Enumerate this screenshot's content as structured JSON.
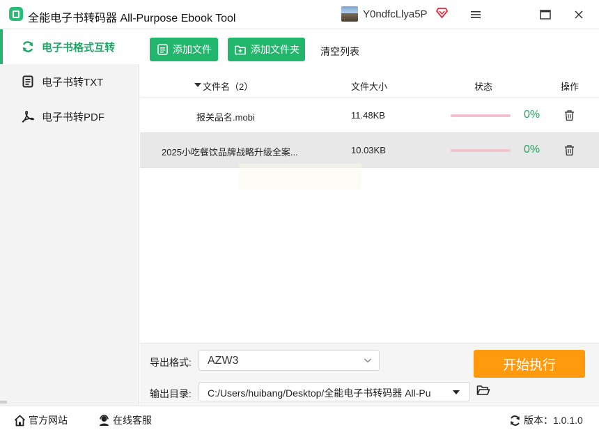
{
  "window": {
    "title": "全能电子书转码器 All-Purpose Ebook Tool",
    "username": "Y0ndfcLlya5P",
    "icons": [
      "menu-icon",
      "maximize-icon",
      "close-icon"
    ]
  },
  "sidebar": {
    "items": [
      {
        "label": "电子书格式互转",
        "icon": "refresh-icon",
        "active": true
      },
      {
        "label": "电子书转TXT",
        "icon": "document-icon",
        "active": false
      },
      {
        "label": "电子书转PDF",
        "icon": "pdf-icon",
        "active": false
      }
    ]
  },
  "toolbar": {
    "add_file": "添加文件",
    "add_folder": "添加文件夹",
    "clear_list": "清空列表"
  },
  "table": {
    "headers": {
      "name": "文件名（2）",
      "size": "文件大小",
      "status": "状态",
      "action": "操作"
    },
    "rows": [
      {
        "name": "报关品名.mobi",
        "size": "11.48KB",
        "progress": 0,
        "percent": "0%"
      },
      {
        "name": "2025小吃餐饮品牌战略升级全案...",
        "size": "10.03KB",
        "progress": 0,
        "percent": "0%"
      }
    ]
  },
  "output": {
    "format_label": "导出格式:",
    "format_value": "AZW3",
    "dir_label": "输出目录:",
    "dir_value": "C:/Users/huibang/Desktop/全能电子书转码器 All-Pu",
    "start_button": "开始执行"
  },
  "statusbar": {
    "website": "官方网站",
    "support": "在线客服",
    "version_label": "版本：",
    "version_value": "1.0.1.0"
  },
  "colors": {
    "accent_green": "#22b66d",
    "start_orange": "#ff9a0e",
    "progress_track": "#f2c3cf",
    "percent_green": "#22a55e"
  }
}
